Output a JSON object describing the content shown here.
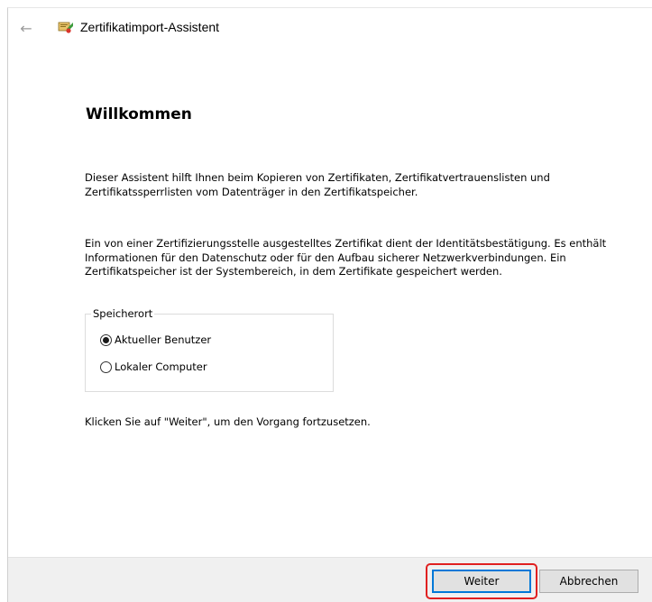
{
  "window": {
    "title": "Zertifikatimport-Assistent",
    "back_icon": "arrow-left-icon",
    "app_icon": "certificate-icon"
  },
  "content": {
    "heading": "Willkommen",
    "paragraph1": "Dieser Assistent hilft Ihnen beim Kopieren von Zertifikaten, Zertifikatvertrauenslisten und Zertifikatssperrlisten vom Datenträger in den Zertifikatspeicher.",
    "paragraph2": "Ein von einer Zertifizierungsstelle ausgestelltes Zertifikat dient der Identitätsbestätigung. Es enthält Informationen für den Datenschutz oder für den Aufbau sicherer Netzwerkverbindungen. Ein Zertifikatspeicher ist der Systembereich, in dem Zertifikate gespeichert werden.",
    "store_location": {
      "legend": "Speicherort",
      "options": [
        {
          "label": "Aktueller Benutzer",
          "checked": true
        },
        {
          "label": "Lokaler Computer",
          "checked": false
        }
      ]
    },
    "paragraph3": "Klicken Sie auf \"Weiter\", um den Vorgang fortzusetzen."
  },
  "footer": {
    "next_label": "Weiter",
    "cancel_label": "Abbrechen"
  },
  "colors": {
    "focus_border": "#0078d7",
    "highlight": "#e02020",
    "footer_bg": "#f0f0f0"
  }
}
